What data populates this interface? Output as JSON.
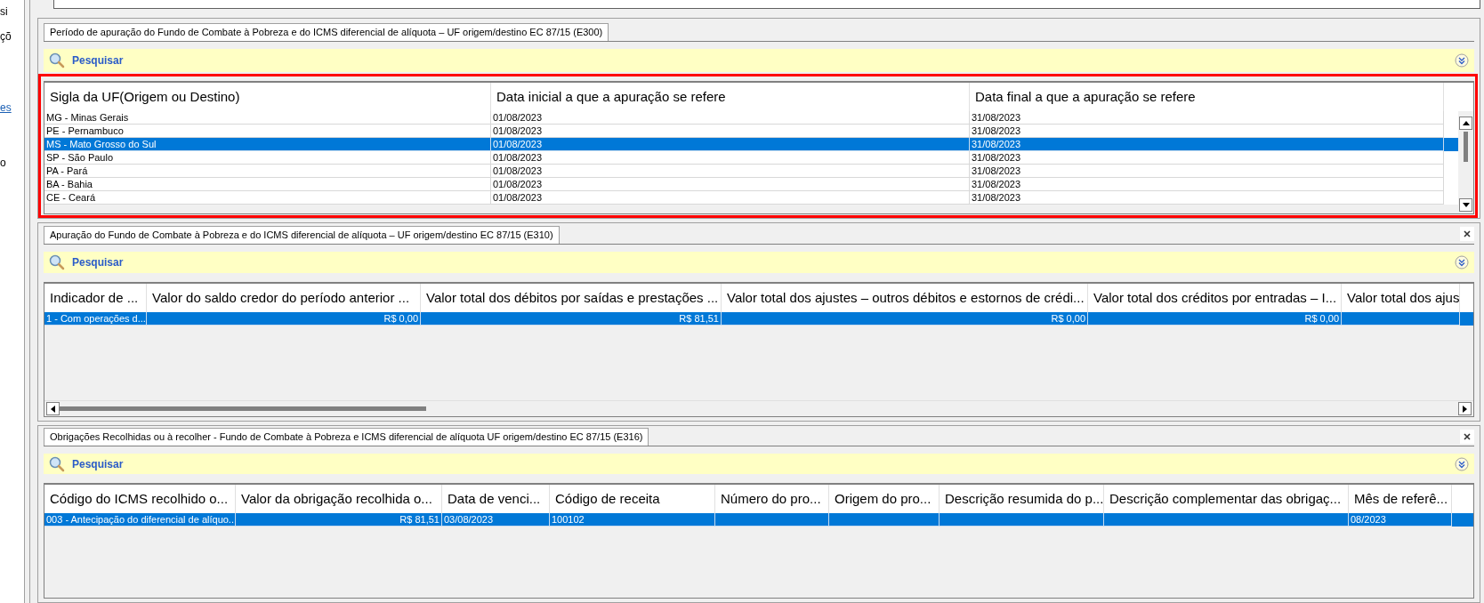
{
  "side_fragments": [
    {
      "text": "si",
      "kind": "plain"
    },
    {
      "text": "çõ",
      "kind": "plain"
    },
    {
      "text": "es",
      "kind": "link"
    },
    {
      "text": "o",
      "kind": "plain"
    }
  ],
  "panels": [
    {
      "tab": "Período de apuração do Fundo de Combate à Pobreza e do ICMS diferencial de alíquota – UF origem/destino EC 87/15 (E300)",
      "closable": false,
      "search": "Pesquisar",
      "highlighted": true,
      "columns": [
        "Sigla da UF(Origem ou Destino)",
        "Data inicial a que a apuração se refere",
        "Data final a que a apuração se refere"
      ],
      "rows": [
        {
          "selected": false,
          "cells": [
            "MG - Minas Gerais",
            "01/08/2023",
            "31/08/2023"
          ]
        },
        {
          "selected": false,
          "cells": [
            "PE - Pernambuco",
            "01/08/2023",
            "31/08/2023"
          ]
        },
        {
          "selected": true,
          "cells": [
            "MS - Mato Grosso do Sul",
            "01/08/2023",
            "31/08/2023"
          ]
        },
        {
          "selected": false,
          "cells": [
            "SP - São Paulo",
            "01/08/2023",
            "31/08/2023"
          ]
        },
        {
          "selected": false,
          "cells": [
            "PA - Pará",
            "01/08/2023",
            "31/08/2023"
          ]
        },
        {
          "selected": false,
          "cells": [
            "BA - Bahia",
            "01/08/2023",
            "31/08/2023"
          ]
        },
        {
          "selected": false,
          "cells": [
            "CE - Ceará",
            "01/08/2023",
            "31/08/2023"
          ]
        }
      ]
    },
    {
      "tab": "Apuração do Fundo de Combate à Pobreza e do ICMS diferencial de alíquota – UF origem/destino EC 87/15 (E310)",
      "closable": true,
      "search": "Pesquisar",
      "highlighted": false,
      "columns": [
        "Indicador de ...",
        "Valor do saldo credor do período anterior ...",
        "Valor total dos débitos por saídas e prestações ...",
        "Valor total dos ajustes – outros débitos e estornos de crédi...",
        "Valor total dos créditos por entradas – I...",
        "Valor total dos ajus"
      ],
      "rows": [
        {
          "selected": true,
          "cells": [
            "1 - Com operações d...",
            "R$ 0,00",
            "R$ 81,51",
            "R$ 0,00",
            "R$ 0,00",
            null
          ]
        }
      ]
    },
    {
      "tab": "Obrigações Recolhidas ou à recolher - Fundo de Combate à Pobreza e ICMS diferencial de alíquota UF origem/destino EC 87/15 (E316)",
      "closable": true,
      "search": "Pesquisar",
      "highlighted": false,
      "columns": [
        "Código do ICMS recolhido o...",
        "Valor da obrigação recolhida o...",
        "Data de venci...",
        "Código de receita",
        "Número do pro...",
        "Origem do pro...",
        "Descrição resumida do p...",
        "Descrição complementar das obrigaç...",
        "Mês de referê..."
      ],
      "rows": [
        {
          "selected": true,
          "cells": [
            "003 - Antecipação do diferencial de alíquo...",
            "R$ 81,51",
            "03/08/2023",
            "100102",
            null,
            null,
            null,
            null,
            "08/2023"
          ]
        }
      ]
    }
  ]
}
